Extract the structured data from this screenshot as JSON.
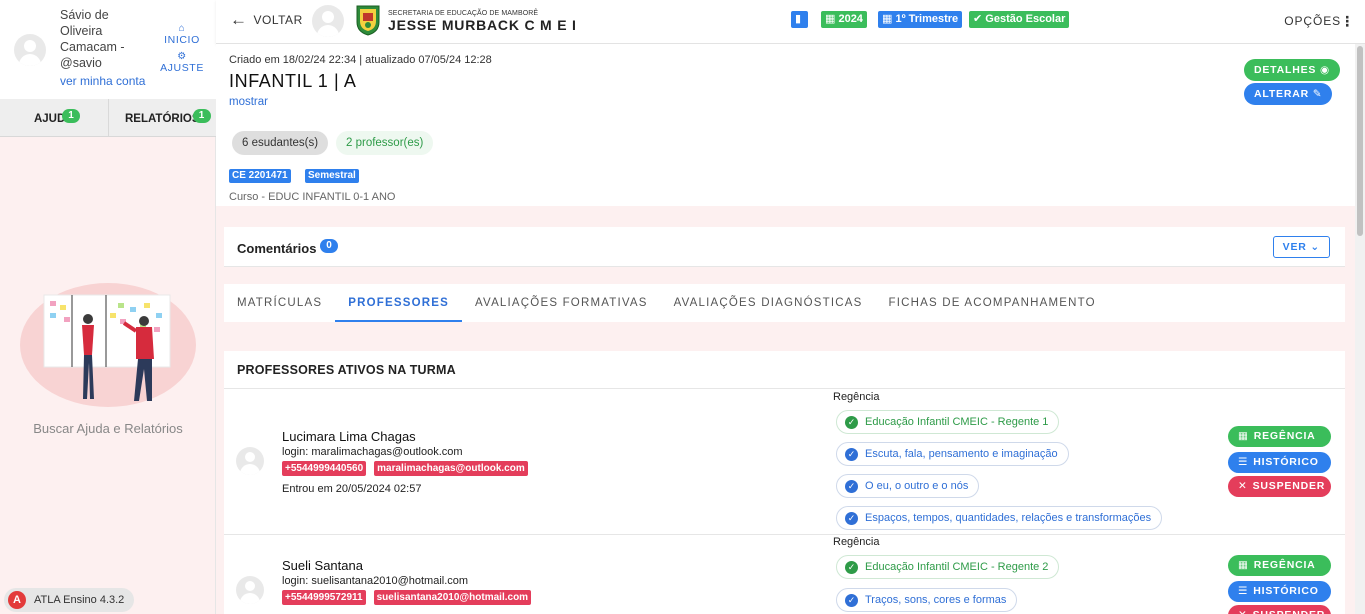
{
  "sidebar": {
    "user_name": "Sávio de Oliveira Camacam - @savio",
    "account_link": "ver minha conta",
    "nav_inicio": "INICIO",
    "nav_ajuste": "AJUSTE",
    "tabs": [
      {
        "label": "AJUDA",
        "badge": "1"
      },
      {
        "label": "RELATÓRIOS",
        "badge": "1"
      }
    ],
    "help_text": "Buscar Ajuda e Relatórios",
    "version": "ATLA Ensino 4.3.2"
  },
  "topbar": {
    "back_label": "VOLTAR",
    "school_line1": "SECRETARIA DE EDUCAÇÃO DE MAMBORÊ",
    "school_line2": "JESSE MURBACK C M E I",
    "pills": [
      {
        "label": "",
        "color": "#2f80ed",
        "icon": "bar-chart-icon"
      },
      {
        "label": "2024",
        "color": "#3bbd5b",
        "icon": "calendar-icon"
      },
      {
        "label": "1º Trimestre",
        "color": "#2f80ed",
        "icon": "calendar-icon"
      },
      {
        "label": "Gestão Escolar",
        "color": "#3bbd5b",
        "icon": "check-circle-icon"
      }
    ],
    "options_label": "OPÇÕES"
  },
  "header": {
    "created": "Criado em 18/02/24 22:34 | atualizado 07/05/24 12:28",
    "title": "INFANTIL 1 | A",
    "show_link": "mostrar",
    "students_chip": "6 esudantes(s)",
    "teachers_chip": "2 professor(es)",
    "tags": [
      "CE 2201471",
      "Semestral"
    ],
    "course": "Curso - EDUC INFANTIL 0-1 ANO",
    "details_button": "DETALHES",
    "edit_button": "ALTERAR"
  },
  "comments": {
    "title": "Comentários",
    "count": "0",
    "view_button": "VER"
  },
  "tabs": [
    {
      "label": "MATRÍCULAS",
      "active": false
    },
    {
      "label": "PROFESSORES",
      "active": true
    },
    {
      "label": "AVALIAÇÕES FORMATIVAS",
      "active": false
    },
    {
      "label": "AVALIAÇÕES DIAGNÓSTICAS",
      "active": false
    },
    {
      "label": "FICHAS DE ACOMPANHAMENTO",
      "active": false
    }
  ],
  "professors": {
    "heading": "PROFESSORES ATIVOS NA TURMA",
    "regencia_label": "Regência",
    "buttons": {
      "regencia": "REGÊNCIA",
      "historico": "HISTÓRICO",
      "suspender": "SUSPENDER"
    },
    "rows": [
      {
        "name": "Lucimara Lima Chagas",
        "login": "login: maralimachagas@outlook.com",
        "phone": "+5544999440560",
        "email": "maralimachagas@outlook.com",
        "entry": "Entrou em 20/05/2024 02:57",
        "regencias": [
          {
            "label": "Educação Infantil CMEIC - Regente 1",
            "status": "green"
          },
          {
            "label": "Escuta, fala, pensamento e imaginação",
            "status": "blue"
          },
          {
            "label": "O eu, o outro e o nós",
            "status": "blue"
          },
          {
            "label": "Espaços, tempos, quantidades, relações e transformações",
            "status": "blue"
          }
        ]
      },
      {
        "name": "Sueli Santana",
        "login": "login: suelisantana2010@hotmail.com",
        "phone": "+5544999572911",
        "email": "suelisantana2010@hotmail.com",
        "entry": "",
        "regencias": [
          {
            "label": "Educação Infantil CMEIC - Regente 2",
            "status": "green"
          },
          {
            "label": "Traços, sons, cores e formas",
            "status": "blue"
          }
        ]
      }
    ]
  },
  "colors": {
    "primary": "#2f80ed",
    "success": "#3bbd5b",
    "danger": "#e43d5b",
    "sidebar_bg": "#fdf0f0"
  }
}
